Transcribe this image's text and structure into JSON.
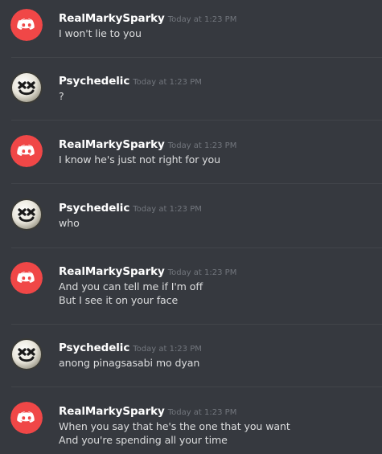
{
  "colors": {
    "background": "#36393f",
    "divider": "#42454a",
    "discord_red": "#f04747",
    "username": "#ffffff",
    "timestamp": "#72767d",
    "message_text": "#dcddde"
  },
  "messages": [
    {
      "author": "RealMarkySparky",
      "avatar": "discord-logo-icon",
      "timestamp": "Today at 1:23 PM",
      "lines": [
        "I won't lie to you"
      ]
    },
    {
      "author": "Psychedelic",
      "avatar": "marshmello-icon",
      "timestamp": "Today at 1:23 PM",
      "lines": [
        "?"
      ]
    },
    {
      "author": "RealMarkySparky",
      "avatar": "discord-logo-icon",
      "timestamp": "Today at 1:23 PM",
      "lines": [
        "I know he's just not right for you"
      ]
    },
    {
      "author": "Psychedelic",
      "avatar": "marshmello-icon",
      "timestamp": "Today at 1:23 PM",
      "lines": [
        "who"
      ]
    },
    {
      "author": "RealMarkySparky",
      "avatar": "discord-logo-icon",
      "timestamp": "Today at 1:23 PM",
      "lines": [
        "And you can tell me if I'm off",
        "But I see it on your face"
      ]
    },
    {
      "author": "Psychedelic",
      "avatar": "marshmello-icon",
      "timestamp": "Today at 1:23 PM",
      "lines": [
        "anong pinagsasabi mo dyan"
      ]
    },
    {
      "author": "RealMarkySparky",
      "avatar": "discord-logo-icon",
      "timestamp": "Today at 1:23 PM",
      "lines": [
        "When you say that he's the one that you want",
        "And you're spending all your time"
      ]
    }
  ]
}
